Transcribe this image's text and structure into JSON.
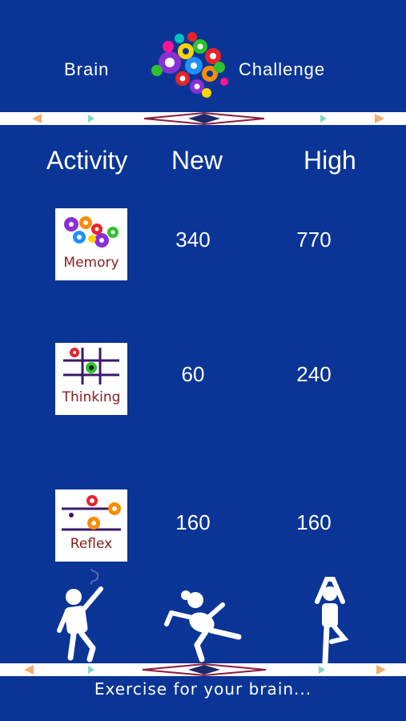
{
  "header": {
    "title_left": "Brain",
    "title_right": "Challenge",
    "logo_icon": "brain-gears-icon"
  },
  "table": {
    "headers": {
      "activity": "Activity",
      "new": "New",
      "high": "High"
    },
    "rows": [
      {
        "name": "Memory",
        "icon": "memory-icon",
        "new": "340",
        "high": "770"
      },
      {
        "name": "Thinking",
        "icon": "thinking-icon",
        "new": "60",
        "high": "240"
      },
      {
        "name": "Reflex",
        "icon": "reflex-icon",
        "new": "160",
        "high": "160"
      }
    ]
  },
  "footer": {
    "tagline": "Exercise for your brain..."
  },
  "colors": {
    "background": "#0a3596",
    "text": "#ffffff",
    "label": "#8a1c1c"
  }
}
